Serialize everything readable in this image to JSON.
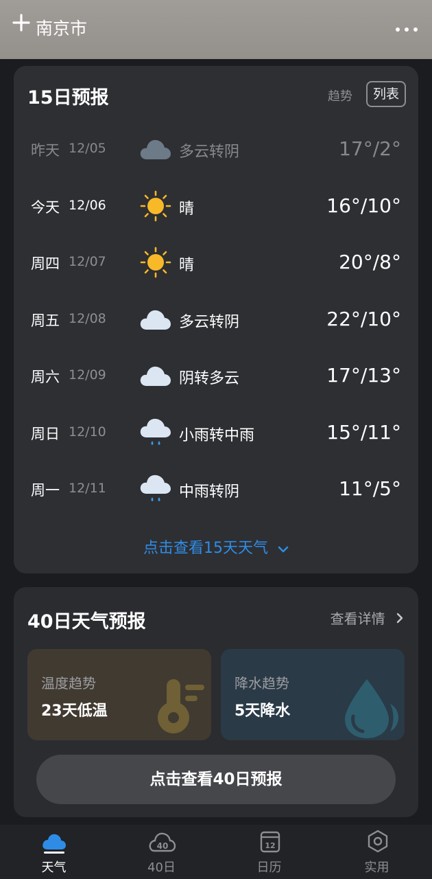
{
  "header": {
    "add_icon": "plus-icon",
    "city": "南京市",
    "more_icon": "more-icon"
  },
  "forecast15": {
    "title": "15日预报",
    "trend_label": "趋势",
    "list_label": "列表",
    "rows": [
      {
        "day": "昨天",
        "date": "12/05",
        "icon": "cloudy-icon",
        "desc": "多云转阴",
        "temp": "17°/2°"
      },
      {
        "day": "今天",
        "date": "12/06",
        "icon": "sunny-icon",
        "desc": "晴",
        "temp": "16°/10°"
      },
      {
        "day": "周四",
        "date": "12/07",
        "icon": "sunny-icon",
        "desc": "晴",
        "temp": "20°/8°"
      },
      {
        "day": "周五",
        "date": "12/08",
        "icon": "cloudy-icon",
        "desc": "多云转阴",
        "temp": "22°/10°"
      },
      {
        "day": "周六",
        "date": "12/09",
        "icon": "cloudy-icon",
        "desc": "阴转多云",
        "temp": "17°/13°"
      },
      {
        "day": "周日",
        "date": "12/10",
        "icon": "rain-icon",
        "desc": "小雨转中雨",
        "temp": "15°/11°"
      },
      {
        "day": "周一",
        "date": "12/11",
        "icon": "rain-icon",
        "desc": "中雨转阴",
        "temp": "11°/5°"
      }
    ],
    "more_label": "点击查看15天天气",
    "more_chevron": "⌄"
  },
  "forecast40": {
    "title": "40日天气预报",
    "detail_label": "查看详情",
    "detail_arrow": "›",
    "temp_tile": {
      "label": "温度趋势",
      "value": "23天低温",
      "icon": "thermometer-icon"
    },
    "rain_tile": {
      "label": "降水趋势",
      "value": "5天降水",
      "icon": "raindrop-icon"
    },
    "button_label": "点击查看40日预报"
  },
  "tabs": [
    {
      "label": "天气",
      "icon": "weather-cloud-icon",
      "active": true
    },
    {
      "label": "40日",
      "icon": "forty-day-icon",
      "icon_text": "40",
      "active": false
    },
    {
      "label": "日历",
      "icon": "calendar-icon",
      "icon_text": "12",
      "active": false
    },
    {
      "label": "实用",
      "icon": "tools-icon",
      "active": false
    }
  ],
  "colors": {
    "accent_blue": "#2f8ce6",
    "sun": "#f7b928",
    "card_bg": "#2e2f33",
    "temp_tile_bg": "#413a31",
    "rain_tile_bg": "#2a3a47"
  }
}
